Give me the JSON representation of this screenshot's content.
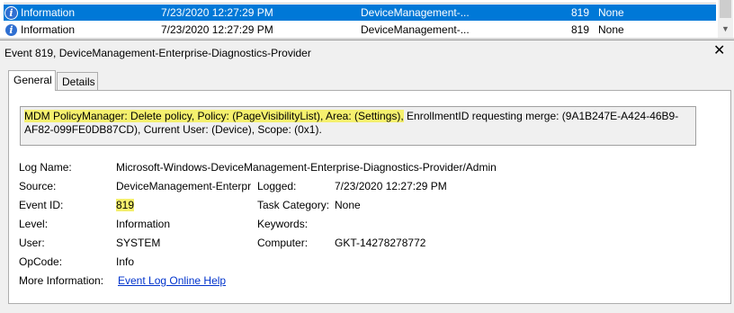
{
  "event_list": {
    "rows": [
      {
        "level": "Information",
        "date_time": "7/23/2020 12:27:29 PM",
        "source": "DeviceManagement-...",
        "event_id": "819",
        "task_category": "None",
        "selected": true
      },
      {
        "level": "Information",
        "date_time": "7/23/2020 12:27:29 PM",
        "source": "DeviceManagement-...",
        "event_id": "819",
        "task_category": "None",
        "selected": false
      }
    ]
  },
  "detail": {
    "title": "Event 819, DeviceManagement-Enterprise-Diagnostics-Provider",
    "close_glyph": "✕",
    "tabs": [
      {
        "label": "General",
        "active": true
      },
      {
        "label": "Details",
        "active": false
      }
    ],
    "message_highlighted": "MDM PolicyManager: Delete policy, Policy: (PageVisibilityList), Area: (Settings),",
    "message_rest": " EnrollmentID requesting merge: (9A1B247E-A424-46B9-AF82-099FE0DB87CD), Current User: (Device), Scope: (0x1).",
    "highlight_color": "#f5f06e",
    "fields": {
      "log_name_label": "Log Name:",
      "log_name": "Microsoft-Windows-DeviceManagement-Enterprise-Diagnostics-Provider/Admin",
      "source_label": "Source:",
      "source": "DeviceManagement-Enterpr",
      "logged_label": "Logged:",
      "logged": "7/23/2020 12:27:29 PM",
      "event_id_label": "Event ID:",
      "event_id": "819",
      "task_category_label": "Task Category:",
      "task_category": "None",
      "level_label": "Level:",
      "level": "Information",
      "keywords_label": "Keywords:",
      "keywords": "",
      "user_label": "User:",
      "user": "SYSTEM",
      "computer_label": "Computer:",
      "computer": "GKT-14278278772",
      "opcode_label": "OpCode:",
      "opcode": "Info",
      "more_info_label": "More Information:",
      "more_info_link": "Event Log Online Help"
    }
  },
  "icons": {
    "row_icon": "information-icon",
    "accent": "#0078d7"
  }
}
